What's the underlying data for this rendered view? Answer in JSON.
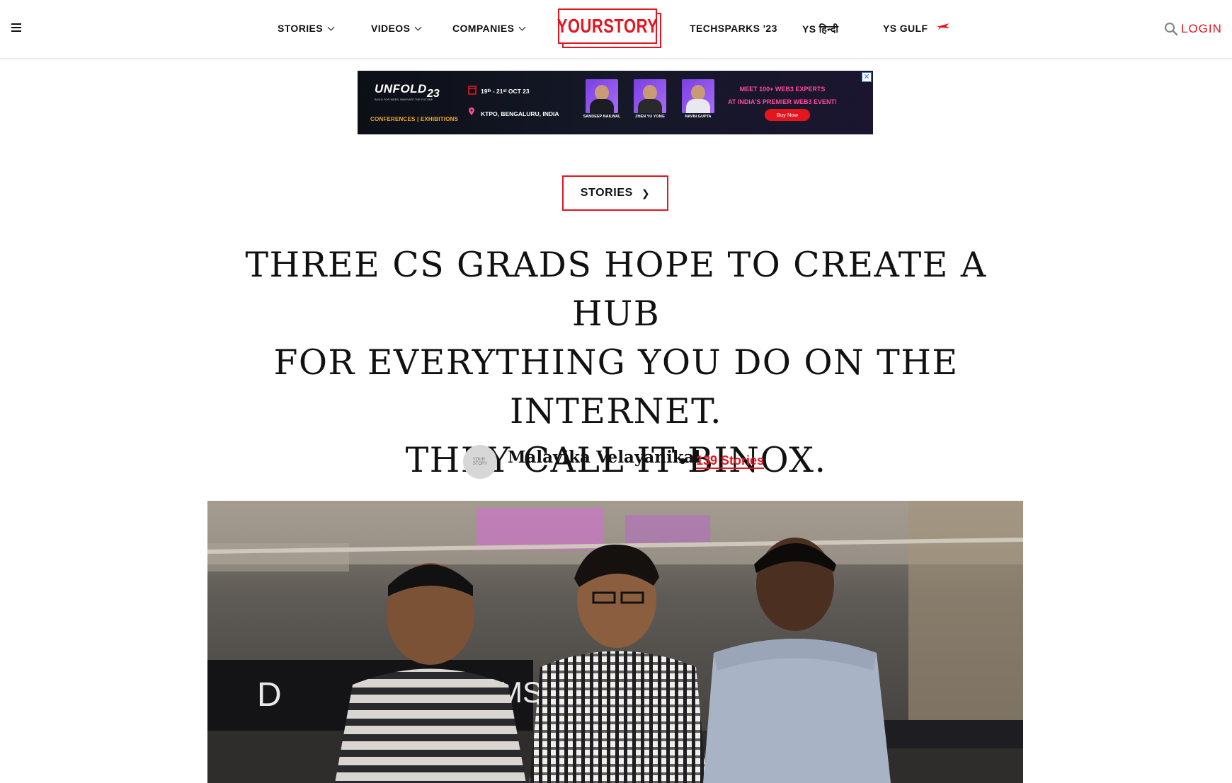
{
  "header": {
    "nav_left": [
      {
        "label": "STORIES"
      },
      {
        "label": "VIDEOS"
      },
      {
        "label": "COMPANIES"
      }
    ],
    "logo_text": "YOURSTORY",
    "nav_right": [
      {
        "label": "TECHSPARKS '23"
      },
      {
        "label": "YS हिन्दी"
      },
      {
        "label": "YS GULF"
      }
    ],
    "login_label": "LOGIN"
  },
  "ad": {
    "brand": "UNFOLD",
    "brand_num": "23",
    "mini": "BUILD FOR WEB3. INNOVATE THE FUTURE",
    "tagline": "CONFERENCES | EXHIBITIONS",
    "date": "19ᵗʰ - 21ˢᵗ OCT 23",
    "location": "KTPO, BENGALURU, INDIA",
    "speakers": [
      {
        "name": "SANDEEP NAILWAL"
      },
      {
        "name": "ZHEN YU YONG"
      },
      {
        "name": "NAVIN GUPTA"
      }
    ],
    "headline_line1": "MEET 100+ WEB3 EXPERTS",
    "headline_line2": "AT INDIA'S PREMIER WEB3 EVENT!",
    "buy_label": "Buy Now",
    "close_label": "✕",
    "colors": {
      "accent": "#e4151f",
      "headline": "#ff4aa0",
      "speaker_bg": "#7b3fe4"
    }
  },
  "article": {
    "category_label": "STORIES",
    "category_arrow": "❯",
    "title_lines": [
      "THREE CS GRADS HOPE TO CREATE A HUB",
      "FOR EVERYTHING YOU DO ON THE INTERNET.",
      "THEY CALL IT BINOX."
    ],
    "author": "Malavika Velayanikal",
    "stories_count_label": "139 Stories",
    "avatar_text_1": "YOUR",
    "avatar_text_2": "STORY"
  },
  "theme": {
    "brand_red": "#e4151f"
  }
}
